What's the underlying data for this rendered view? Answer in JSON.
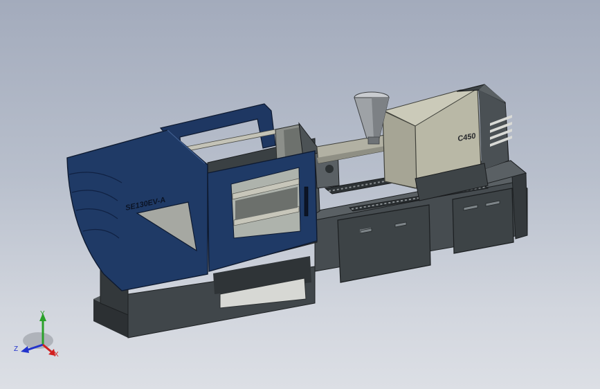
{
  "viewport": {
    "background_top": "#a3abbc",
    "background_bottom": "#dcdfe5"
  },
  "model": {
    "clamp_unit_label": "SE130EV-A",
    "injection_unit_label": "C450",
    "colors": {
      "clamp_blue": "#1f3a66",
      "frame_dark": "#3f4548",
      "barrel_gray": "#b9b8a6",
      "hopper_gray": "#9ea2a6"
    }
  },
  "triad": {
    "x_label": "X",
    "y_label": "Y",
    "z_label": "Z",
    "x_color": "#d21f1f",
    "y_color": "#2aa12a",
    "z_color": "#2233cc"
  }
}
